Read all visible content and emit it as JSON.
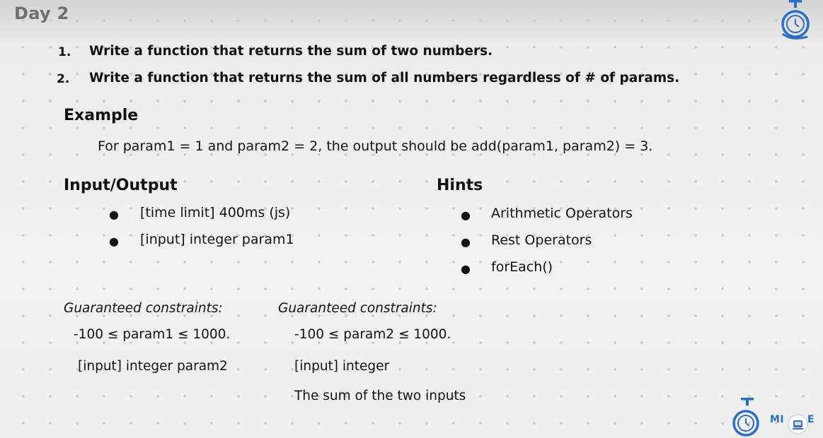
{
  "day_title": "Day 2",
  "tasks": [
    {
      "number": "1.",
      "text": "Write a function that returns the sum of two numbers."
    },
    {
      "number": "2.",
      "text": "Write a function that returns the sum of all numbers regardless of # of params."
    }
  ],
  "example": {
    "heading": "Example",
    "text": "For param1 = 1 and param2 = 2, the output should be add(param1, param2) = 3."
  },
  "io": {
    "heading": "Input/Output",
    "bullets": [
      "[time limit] 400ms (js)",
      "[input] integer param1"
    ]
  },
  "hints": {
    "heading": "Hints",
    "bullets": [
      "Arithmetic Operators",
      "Rest Operators",
      "forEach()"
    ]
  },
  "bullet_glyph": "●",
  "constraints_left": {
    "heading": "Guaranteed constraints:",
    "range": "-100 ≤ param1 ≤ 1000.",
    "input": "[input] integer param2"
  },
  "constraints_right": {
    "heading": "Guaranteed constraints:",
    "range": "-100 ≤ param2 ≤ 1000.",
    "input": "[input] integer",
    "output": "The sum of the two inputs"
  },
  "brand": {
    "text": "MI",
    "tail": "E"
  },
  "colors": {
    "brand_blue": "#2a6ec9",
    "text": "#111111",
    "title_gray": "#6f6f6f"
  },
  "icons": [
    "stopwatch-logo-icon",
    "stopwatch-logo-icon",
    "avatar-badge-icon"
  ]
}
